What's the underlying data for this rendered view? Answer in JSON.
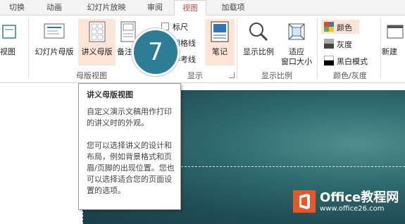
{
  "tabs": {
    "items": [
      "切换",
      "动画",
      "幻灯片放映",
      "审阅",
      "视图",
      "加载项"
    ],
    "active": "视图"
  },
  "ribbon": {
    "partial_view_label": "视图",
    "master_views": {
      "slide_master": "幻灯片母版",
      "handout_master": "讲义母版",
      "notes_master_partial": "备注",
      "group_label": "母版视图"
    },
    "show": {
      "ruler": "标尺",
      "gridlines": "网格线",
      "guides": "参考线",
      "notes": "笔记",
      "group_label": "显示"
    },
    "zoom": {
      "zoom": "显示比例",
      "fit_line1": "适应",
      "fit_line2": "窗口大小",
      "group_label": "显示比例"
    },
    "color": {
      "color": "颜色",
      "grayscale": "灰度",
      "bw": "黑白模式",
      "group_label": "颜色/灰度"
    },
    "new_window_partial": "新建"
  },
  "callout_number": "7",
  "tooltip": {
    "title": "讲义母版视图",
    "para1": "自定义演示文稿用作打印的讲义时的外观。",
    "para2": "您可以选择讲义的设计和布局，例如背景格式和页眉/页脚的出现位置。您也可以选择适合您的页面设置的选项。"
  },
  "watermark": {
    "name": "Office教程网",
    "url": "www.office26.com"
  },
  "colors": {
    "accent_tab": "#c0504d",
    "highlight": "#fce4d6",
    "callout": "#2d7d96",
    "logo": "#e8562a"
  }
}
